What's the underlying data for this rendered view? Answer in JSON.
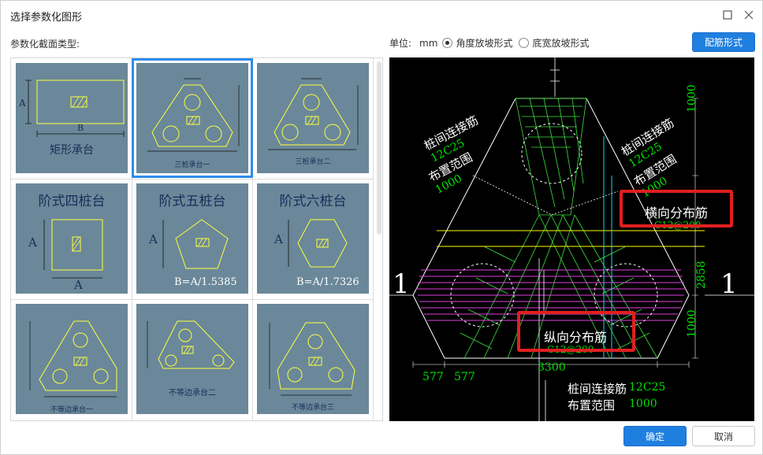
{
  "window": {
    "title": "选择参数化图形"
  },
  "section_label": "参数化截面类型:",
  "units": {
    "label": "单位:",
    "value": "mm",
    "options": [
      {
        "label": "角度放坡形式",
        "selected": true
      },
      {
        "label": "底宽放坡形式",
        "selected": false
      }
    ]
  },
  "buttons": {
    "rebar": "配筋形式",
    "ok": "确定",
    "cancel": "取消"
  },
  "shapes": [
    {
      "caption": "矩形承台",
      "dim_a": "A",
      "dim_b": "B"
    },
    {
      "caption": "三桩承台一",
      "selected": true
    },
    {
      "caption": "三桩承台二"
    },
    {
      "caption": "阶式四桩台",
      "dim_a": "A",
      "dim_b": "A"
    },
    {
      "caption": "阶式五桩台",
      "dim_a": "A",
      "formula": "B=A/1.5385"
    },
    {
      "caption": "阶式六桩台",
      "dim_a": "A",
      "formula": "B=A/1.7326"
    },
    {
      "caption": "不等边承台一"
    },
    {
      "caption": "不等边承台二"
    },
    {
      "caption": "不等边承台三"
    }
  ],
  "preview": {
    "section_mark_left": "1",
    "section_mark_right": "1",
    "left_label_title": "桩间连接筋",
    "left_label_spec": "12C25",
    "left_label_range": "布置范围",
    "left_label_range_val": "1000",
    "right_label_title": "桩间连接筋",
    "right_label_spec": "12C25",
    "right_label_range": "布置范围",
    "right_label_range_val": "1000",
    "transverse_title": "横向分布筋",
    "transverse_spec": "C12@200",
    "longitudinal_title": "纵向分布筋",
    "longitudinal_spec": "C12@200",
    "bottom_label_title": "桩间连接筋",
    "bottom_label_spec": "12C25",
    "bottom_label_range": "布置范围",
    "bottom_label_range_val": "1000",
    "dim_right_top": "1000",
    "dim_right_mid": "2858",
    "dim_right_bottom": "1000",
    "dim_bottom_total": "3300",
    "dim_bottom_left": "577",
    "dim_bottom_left2": "577"
  },
  "colors": {
    "accent": "#1f7fe0",
    "thumb_bg": "#6a8899",
    "cad_green": "#00e000",
    "cad_magenta": "#e040e0",
    "cad_yellow": "#ffff00",
    "cad_cyan": "#00e0ff",
    "highlight": "#e01f1f"
  }
}
